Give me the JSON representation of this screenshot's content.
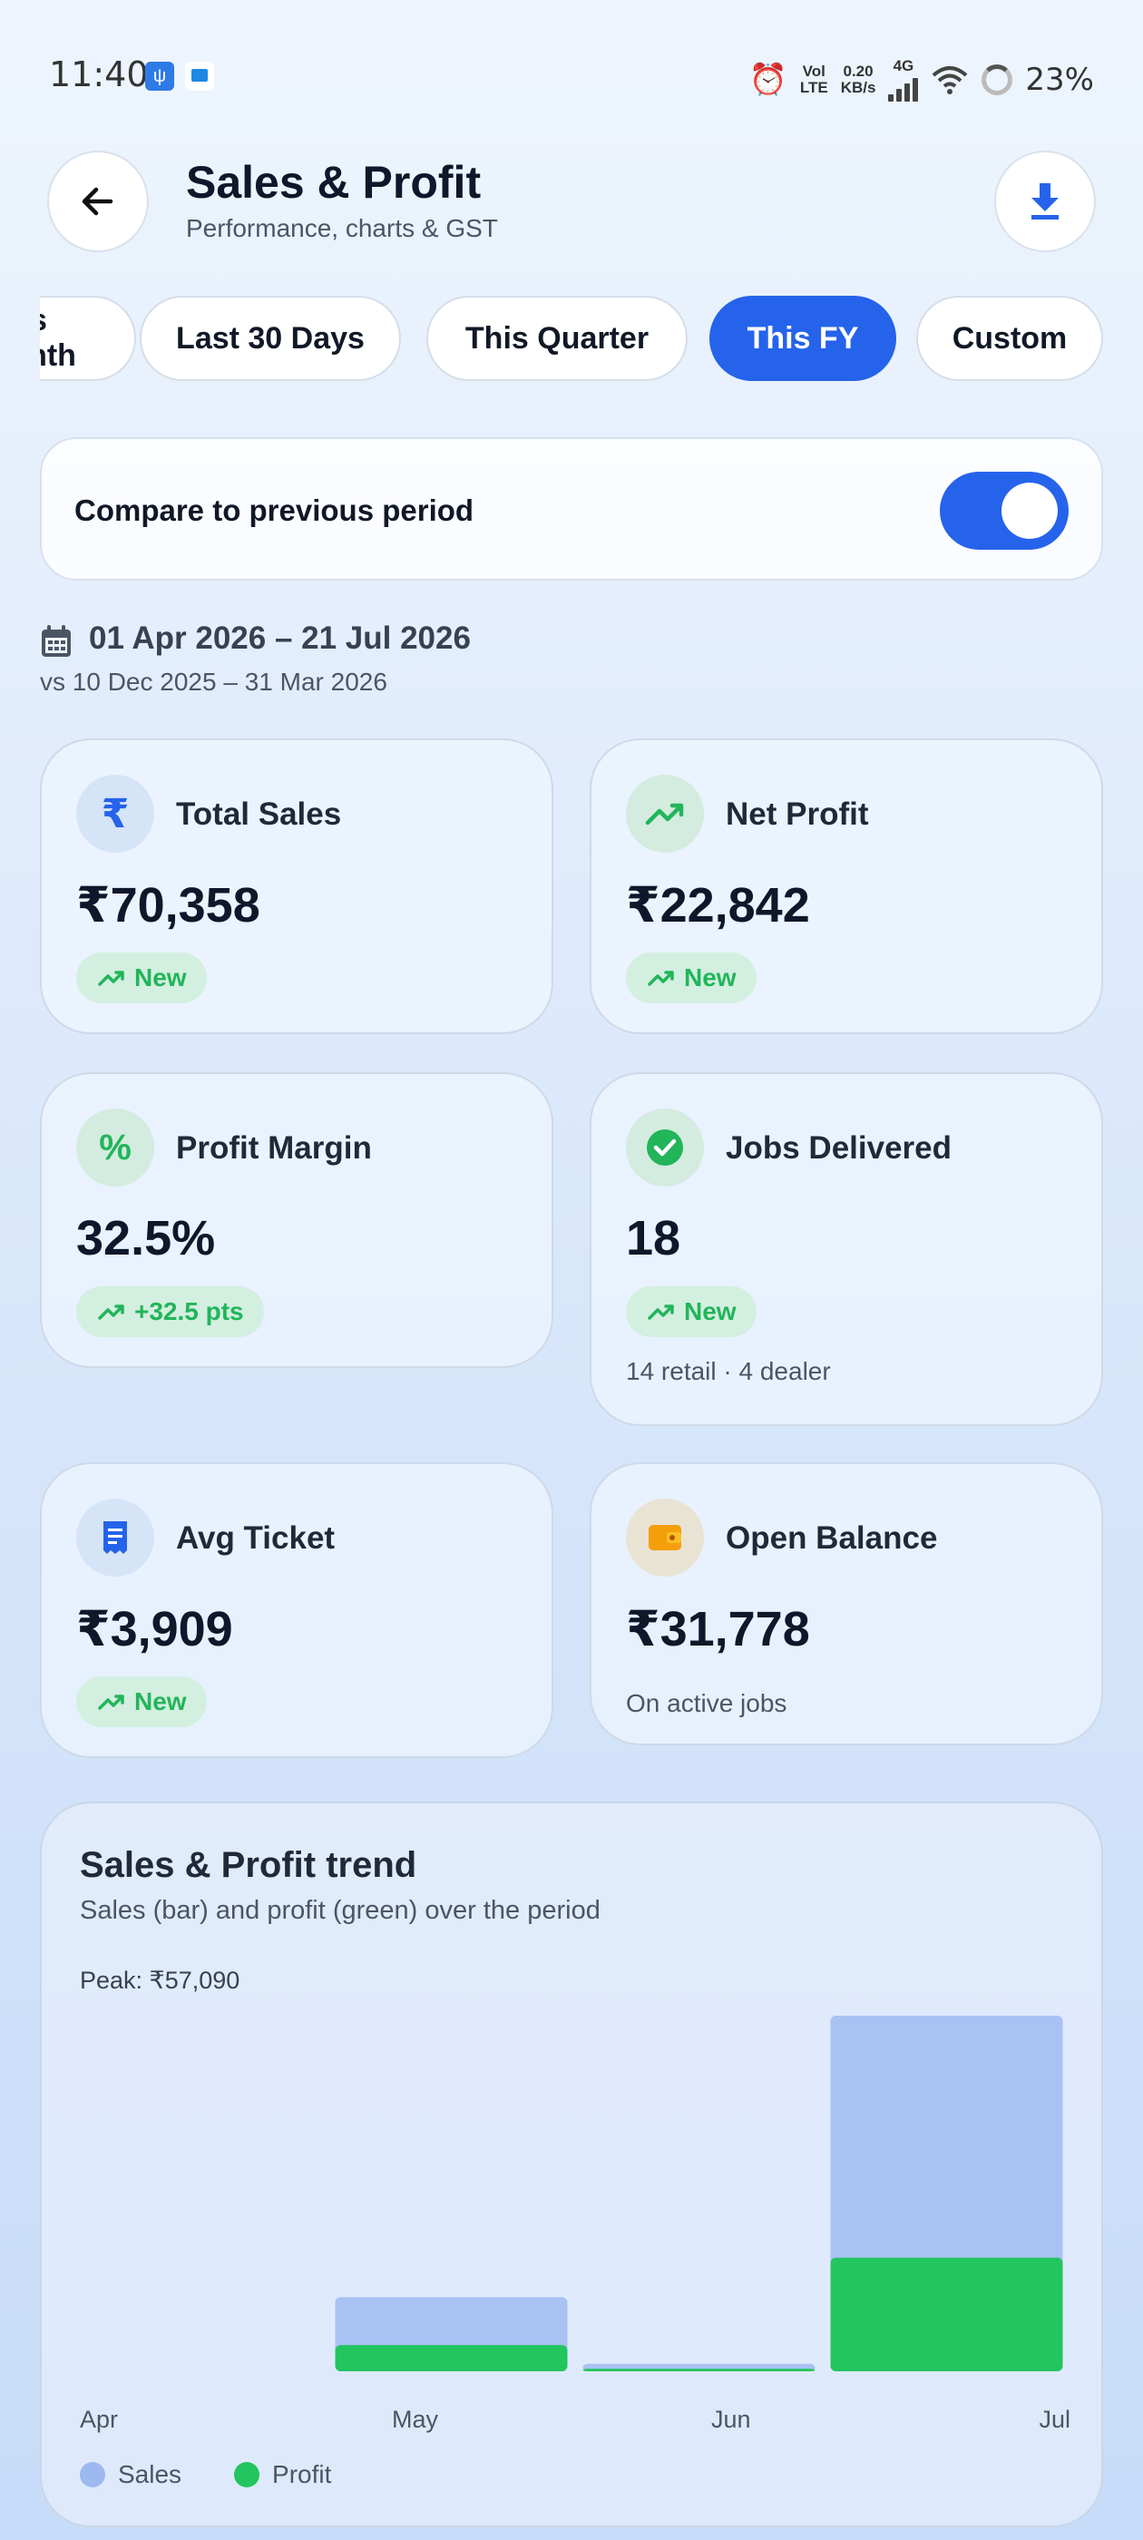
{
  "status_bar": {
    "time": "11:40",
    "net_top": "Vol",
    "net_bottom": "LTE",
    "speed_top": "0.20",
    "speed_bottom": "KB/s",
    "network": "4G",
    "battery": "23%"
  },
  "header": {
    "title": "Sales & Profit",
    "subtitle": "Performance, charts & GST"
  },
  "chips": [
    {
      "label": "This Month",
      "active": false
    },
    {
      "label": "Last 30 Days",
      "active": false
    },
    {
      "label": "This Quarter",
      "active": false
    },
    {
      "label": "This FY",
      "active": true
    },
    {
      "label": "Custom",
      "active": false
    }
  ],
  "compare": {
    "label": "Compare to previous period",
    "enabled": true
  },
  "date_range": {
    "current": "01 Apr 2026  –  21 Jul 2026",
    "previous": "vs 10 Dec 2025 – 31 Mar 2026"
  },
  "metrics": {
    "total_sales": {
      "title": "Total Sales",
      "value": "₹70,358",
      "badge": "New"
    },
    "net_profit": {
      "title": "Net Profit",
      "value": "₹22,842",
      "badge": "New"
    },
    "profit_margin": {
      "title": "Profit Margin",
      "value": "32.5%",
      "badge": "+32.5 pts"
    },
    "jobs_delivered": {
      "title": "Jobs Delivered",
      "value": "18",
      "badge": "New",
      "note": "14 retail · 4 dealer"
    },
    "avg_ticket": {
      "title": "Avg Ticket",
      "value": "₹3,909",
      "badge": "New"
    },
    "open_balance": {
      "title": "Open Balance",
      "value": "₹31,778",
      "note": "On active jobs"
    }
  },
  "trend": {
    "title": "Sales & Profit trend",
    "subtitle": "Sales (bar) and profit (green) over the period",
    "peak": "Peak: ₹57,090",
    "legend_sales": "Sales",
    "legend_profit": "Profit"
  },
  "colors": {
    "accent": "#2563eb",
    "sales_bar": "#a8c2f4",
    "profit_bar": "#22c55e",
    "positive": "#22b55a"
  },
  "chart_data": {
    "type": "bar",
    "categories": [
      "Apr",
      "May",
      "Jun",
      "Jul"
    ],
    "series": [
      {
        "name": "Sales",
        "values": [
          0,
          11900,
          1200,
          57090
        ]
      },
      {
        "name": "Profit",
        "values": [
          0,
          4200,
          400,
          18240
        ]
      }
    ],
    "ylim": [
      0,
      57090
    ]
  }
}
